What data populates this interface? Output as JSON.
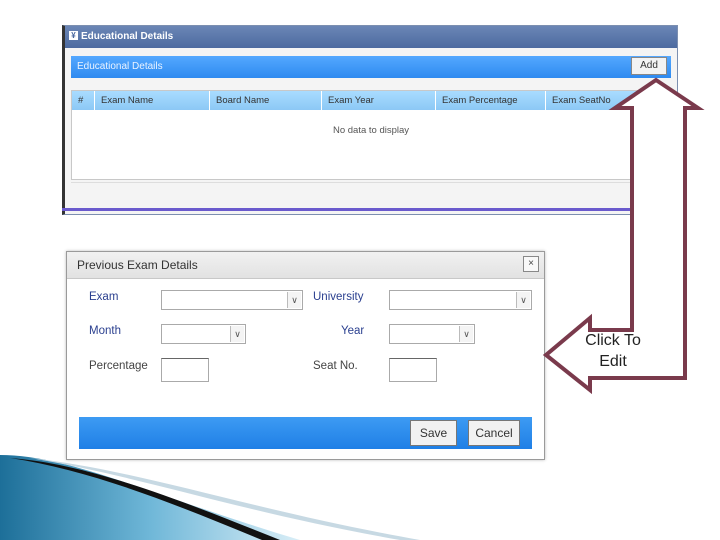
{
  "edu_panel": {
    "title": "Educational Details",
    "subheader": "Educational Details",
    "add_label": "Add",
    "columns": [
      "#",
      "Exam Name",
      "Board Name",
      "Exam Year",
      "Exam Percentage",
      "Exam SeatNo"
    ],
    "empty_message": "No data to display"
  },
  "dialog": {
    "title": "Previous Exam Details",
    "close_glyph": "×",
    "exam_label": "Exam",
    "university_label": "University",
    "month_label": "Month",
    "year_label": "Year",
    "percentage_label": "Percentage",
    "seat_label": "Seat No.",
    "dropdown_glyph": "∨",
    "save_label": "Save",
    "cancel_label": "Cancel"
  },
  "callout": {
    "text_line1": "Click To",
    "text_line2": "Edit"
  },
  "colors": {
    "title_bar": "#4c6aa0",
    "subheader": "#2e8af0",
    "grid_header": "#8cc8f5",
    "arrow_outline": "#7a3a4c",
    "dialog_footer": "#1f7fe6"
  }
}
